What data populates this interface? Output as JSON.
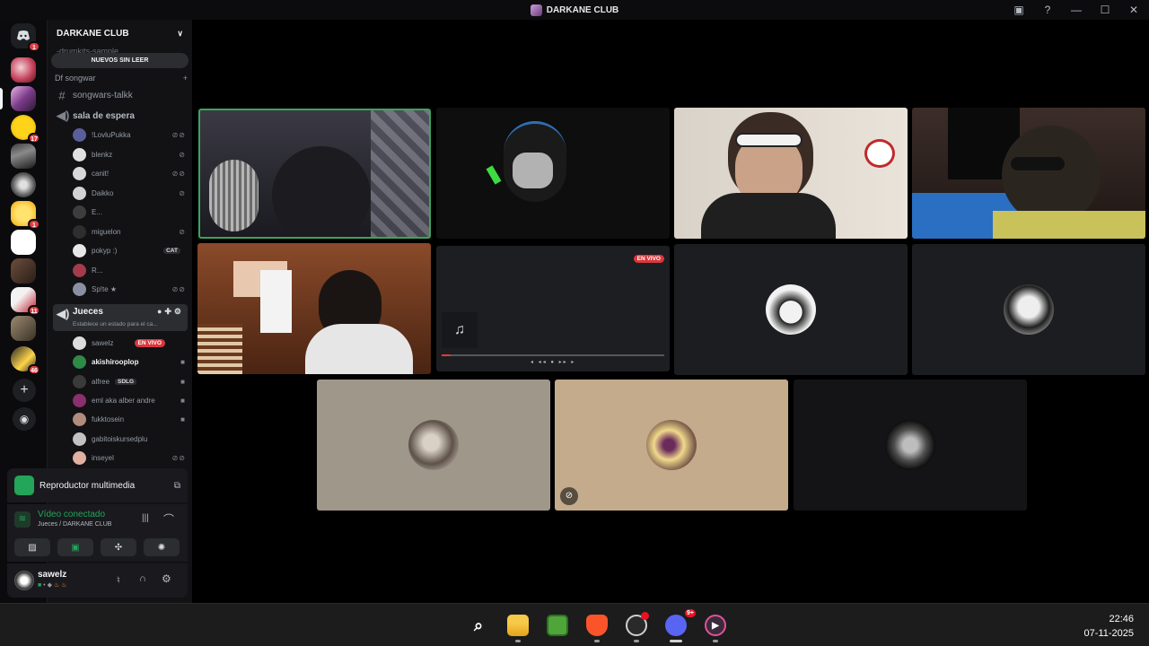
{
  "window": {
    "title": "DARKANE CLUB"
  },
  "server": {
    "name": "DARKANE CLUB",
    "faded_channel": "-drumkits-sample...",
    "unread_label": "NUEVOS SIN LEER"
  },
  "category": {
    "name": "Df songwar"
  },
  "channels": {
    "text": "songwars-talkk",
    "voice1": "sala de espera",
    "voice2": "Jueces",
    "voice2_status": "Establece un estado para el ca..."
  },
  "waiting_members": [
    "!LovluPukka",
    "blenkz",
    "canit!",
    "Daikko",
    "E...",
    "miguelon",
    "pokyp :)",
    "R...",
    "Sp!te ★"
  ],
  "pokyp_tag": "CAT",
  "judge_members": [
    "sawelz",
    "akishirooplop",
    "alfree",
    "eml aka alber andre",
    "fukktosein",
    "gabitoiskursedplu",
    "inseyel"
  ],
  "alfree_tag": "SDLG",
  "live_label": "EN VIVO",
  "server_badges": {
    "home": "1",
    "s3": "17",
    "s6": "1",
    "s9": "11",
    "s11": "46"
  },
  "media_player": {
    "title": "Reproductor multimedia"
  },
  "voice": {
    "status": "Vídeo conectado",
    "location": "Jueces / DARKANE CLUB"
  },
  "user": {
    "name": "sawelz"
  },
  "taskbar": {
    "time": "22:46",
    "date": "07-11-2025",
    "discord_badge": "9+"
  },
  "colors": {
    "accent_green": "#23a55a",
    "live_red": "#da373c",
    "speaking_border": "#3ba55c"
  },
  "icons": {
    "rail": [
      "discord-logo-icon",
      "add-server-icon",
      "discover-icon"
    ],
    "voice": [
      "speaker-icon",
      "soundwave-icon",
      "disconnect-icon"
    ],
    "user": [
      "mic-icon",
      "headphones-icon",
      "gear-icon"
    ],
    "taskbar": [
      "windows-start-icon",
      "search-icon",
      "file-explorer-icon",
      "minecraft-icon",
      "brave-icon",
      "obs-icon",
      "discord-icon",
      "media-player-icon"
    ]
  }
}
